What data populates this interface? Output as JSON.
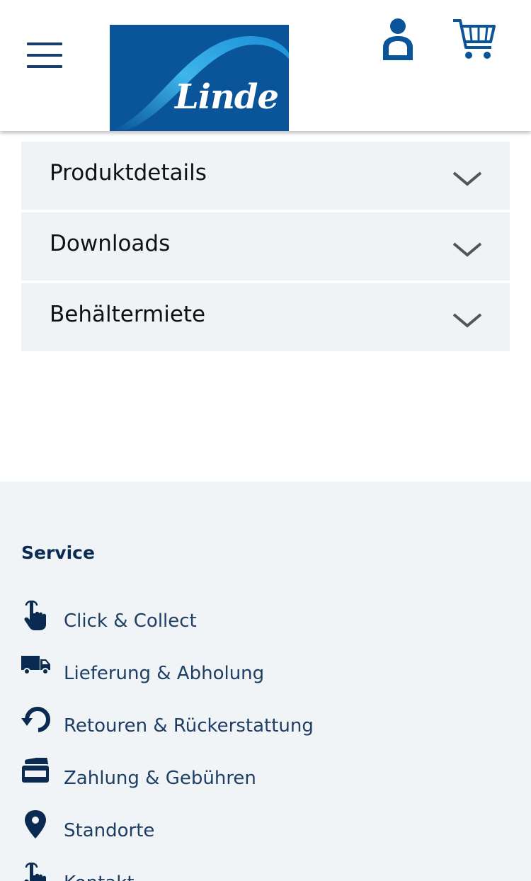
{
  "header": {
    "logo_text": "Linde",
    "icons": {
      "menu": "hamburger-menu-icon",
      "account": "user-icon",
      "cart": "cart-icon"
    },
    "brand_color": "#0a5499"
  },
  "accordion": {
    "items": [
      {
        "label": "Produktdetails",
        "icon": "chevron-down-icon"
      },
      {
        "label": "Downloads",
        "icon": "chevron-down-icon"
      },
      {
        "label": "Behältermiete",
        "icon": "chevron-down-icon"
      }
    ]
  },
  "footer": {
    "title": "Service",
    "items": [
      {
        "label": "Click & Collect",
        "icon": "hand-pointer-icon"
      },
      {
        "label": "Lieferung & Abholung",
        "icon": "truck-icon"
      },
      {
        "label": "Retouren & Rückerstattung",
        "icon": "undo-icon"
      },
      {
        "label": "Zahlung & Gebühren",
        "icon": "credit-card-icon"
      },
      {
        "label": "Standorte",
        "icon": "map-pin-icon"
      },
      {
        "label": "Kontakt",
        "icon": "hand-pointer-icon"
      }
    ]
  },
  "colors": {
    "accent_dark": "#0b2a52",
    "link": "#1e3e63",
    "panel_bg": "#f0f3f5"
  }
}
